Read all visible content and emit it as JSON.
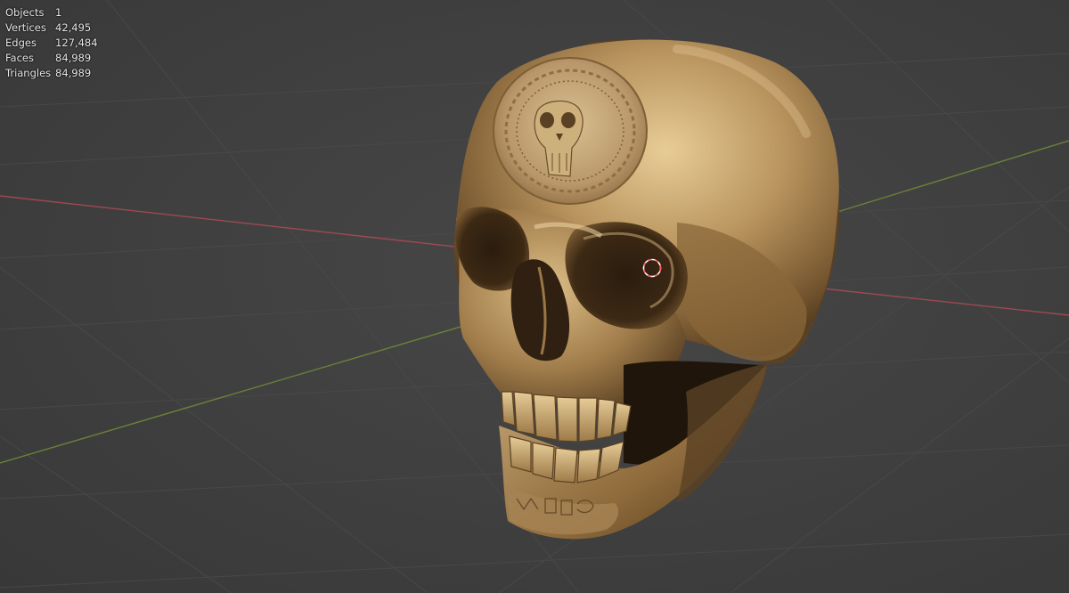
{
  "overlay": {
    "stats": [
      {
        "label": "Objects",
        "value": "1"
      },
      {
        "label": "Vertices",
        "value": "42,495"
      },
      {
        "label": "Edges",
        "value": "127,484"
      },
      {
        "label": "Faces",
        "value": "84,989"
      },
      {
        "label": "Triangles",
        "value": "84,989"
      }
    ]
  },
  "colors": {
    "background": "#3d3d3d",
    "grid_line": "#4a4a4a",
    "x_axis": "#a84b55",
    "y_axis": "#6f8a38",
    "gold_light": "#e3c58e",
    "gold_mid": "#a88452",
    "gold_dark": "#4a341b",
    "cursor_red": "#ff5c5c",
    "cursor_white": "#ffffff"
  },
  "viewport": {
    "object_icon": "golden-skull-mesh",
    "cursor_icon": "3d-cursor-icon"
  }
}
